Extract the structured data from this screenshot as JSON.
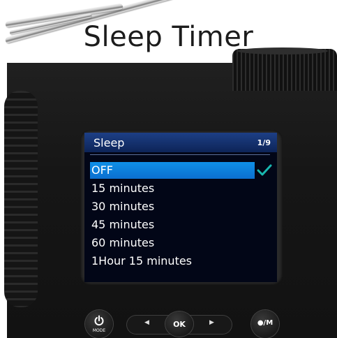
{
  "title": "Sleep Timer",
  "screen": {
    "header_title": "Sleep",
    "page_indicator": "1/9",
    "items": [
      {
        "label": "OFF",
        "selected": true
      },
      {
        "label": "15 minutes"
      },
      {
        "label": "30 minutes"
      },
      {
        "label": "45 minutes"
      },
      {
        "label": "60 minutes"
      },
      {
        "label": "1Hour 15 minutes"
      }
    ],
    "accent_color": "#0b7fe0",
    "check_color": "#18b7b0"
  },
  "controls": {
    "mode_label": "MODE",
    "ok_label": "OK",
    "play_label": "●/M"
  }
}
